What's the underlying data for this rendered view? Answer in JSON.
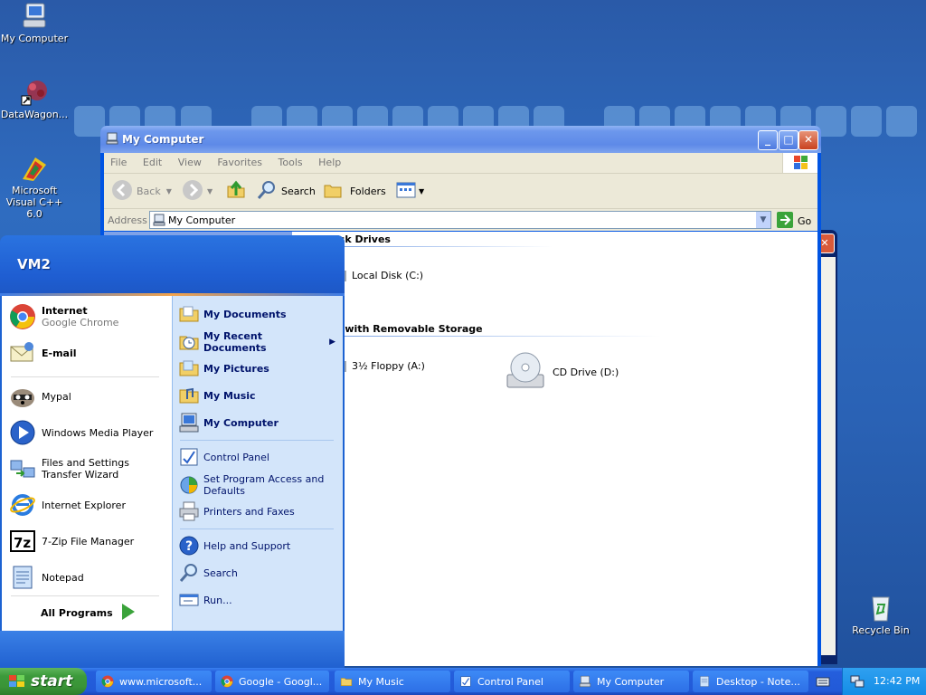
{
  "desktop": {
    "icons": [
      {
        "label": "My Computer",
        "icon": "my-computer-icon"
      },
      {
        "label": "DataWagon...",
        "icon": "datawagon-shortcut-icon"
      },
      {
        "label": "Microsoft Visual C++ 6.0",
        "icon": "visual-cpp-icon"
      },
      {
        "label": "Recycle Bin",
        "icon": "recycle-bin-icon"
      }
    ]
  },
  "window": {
    "title": "My Computer",
    "menu": [
      "File",
      "Edit",
      "View",
      "Favorites",
      "Tools",
      "Help"
    ],
    "toolbar": {
      "back": "Back",
      "search": "Search",
      "folders": "Folders"
    },
    "address": {
      "label": "Address",
      "value": "My Computer",
      "go": "Go"
    },
    "groups": [
      {
        "title": "Hard Disk Drives",
        "visible_title": "isk Drives",
        "items": [
          "Local Disk (C:)"
        ]
      },
      {
        "title": "Devices with Removable Storage",
        "visible_title": "s with Removable Storage",
        "items": [
          "3½ Floppy (A:)",
          "CD Drive (D:)"
        ]
      }
    ]
  },
  "start_menu": {
    "user": "VM2",
    "pinned": [
      {
        "label": "Internet",
        "sub": "Google Chrome",
        "icon": "chrome-icon"
      },
      {
        "label": "E-mail",
        "icon": "email-icon"
      }
    ],
    "recent": [
      {
        "label": "Mypal",
        "icon": "mypal-icon"
      },
      {
        "label": "Windows Media Player",
        "icon": "media-player-icon"
      },
      {
        "label": "Files and Settings Transfer Wizard",
        "icon": "transfer-wizard-icon"
      },
      {
        "label": "Internet Explorer",
        "icon": "internet-explorer-icon"
      },
      {
        "label": "7-Zip File Manager",
        "icon": "7zip-icon"
      },
      {
        "label": "Notepad",
        "icon": "notepad-icon"
      }
    ],
    "all_programs": "All Programs",
    "right": [
      {
        "label": "My Documents",
        "icon": "folder-icon"
      },
      {
        "label": "My Recent Documents",
        "icon": "recent-documents-icon"
      },
      {
        "label": "My Pictures",
        "icon": "folder-icon"
      },
      {
        "label": "My Music",
        "icon": "folder-icon"
      },
      {
        "label": "My Computer",
        "icon": "computer-icon"
      },
      {
        "label": "Control Panel",
        "icon": "control-panel-icon"
      },
      {
        "label": "Set Program Access and Defaults",
        "icon": "program-access-icon"
      },
      {
        "label": "Printers and Faxes",
        "icon": "printer-icon"
      },
      {
        "label": "Help and Support",
        "icon": "help-icon"
      },
      {
        "label": "Search",
        "icon": "search-icon"
      },
      {
        "label": "Run...",
        "icon": "run-icon"
      }
    ]
  },
  "taskbar": {
    "start": "start",
    "tasks": [
      {
        "label": "www.microsoft...",
        "icon": "chrome-icon"
      },
      {
        "label": "Google - Googl...",
        "icon": "chrome-icon"
      },
      {
        "label": "My Music",
        "icon": "folder-icon"
      },
      {
        "label": "Control Panel",
        "icon": "control-panel-icon"
      },
      {
        "label": "My Computer",
        "icon": "computer-icon"
      },
      {
        "label": "Desktop - Note...",
        "icon": "notepad-icon"
      }
    ],
    "clock": "12:42 PM"
  }
}
